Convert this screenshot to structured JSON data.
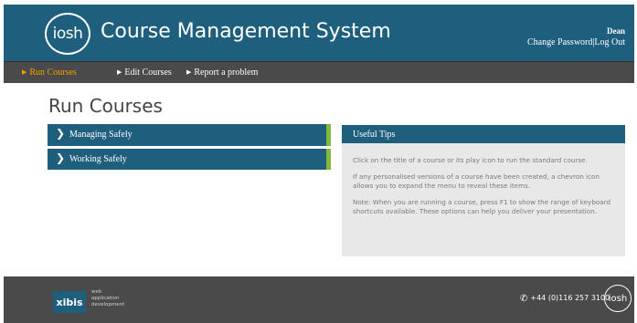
{
  "header": {
    "logo_text": "iosh",
    "app_title": "Course Management System",
    "user_name": "Dean",
    "change_password": "Change Password",
    "separator": "|",
    "log_out": "Log Out"
  },
  "nav": {
    "items": [
      {
        "label": "Run Courses",
        "active": true
      },
      {
        "label": "Edit Courses",
        "active": false
      },
      {
        "label": "Report a problem",
        "active": false
      }
    ]
  },
  "page": {
    "title": "Run Courses"
  },
  "courses": [
    {
      "label": "Managing Safely"
    },
    {
      "label": "Working Safely"
    }
  ],
  "tips": {
    "heading": "Useful Tips",
    "paragraphs": [
      "Click on the title of a course or its play icon to run the standard course.",
      "If any personalised versions of a course have been created, a chevron icon allows you to expand the menu to reveal these items.",
      "Note: When you are running a course, press F1 to show the range of keyboard shortcuts available. These options can help you deliver your presentation."
    ]
  },
  "footer": {
    "xibis_logo": "xibis",
    "xibis_tagline_1": "web",
    "xibis_tagline_2": "application",
    "xibis_tagline_3": "development",
    "phone": "+44 (0)116 257 3100",
    "logo_text": "iosh"
  },
  "colors": {
    "header_bg": "#1f5f7e",
    "nav_bg": "#4a4a4a",
    "nav_active": "#f4a100",
    "accent_green": "#7fb93b",
    "tips_bg": "#e8e8e8"
  },
  "icons": {
    "nav_arrow": "triangle-right-icon",
    "course_chevron": "chevron-right-icon",
    "phone": "phone-icon"
  }
}
